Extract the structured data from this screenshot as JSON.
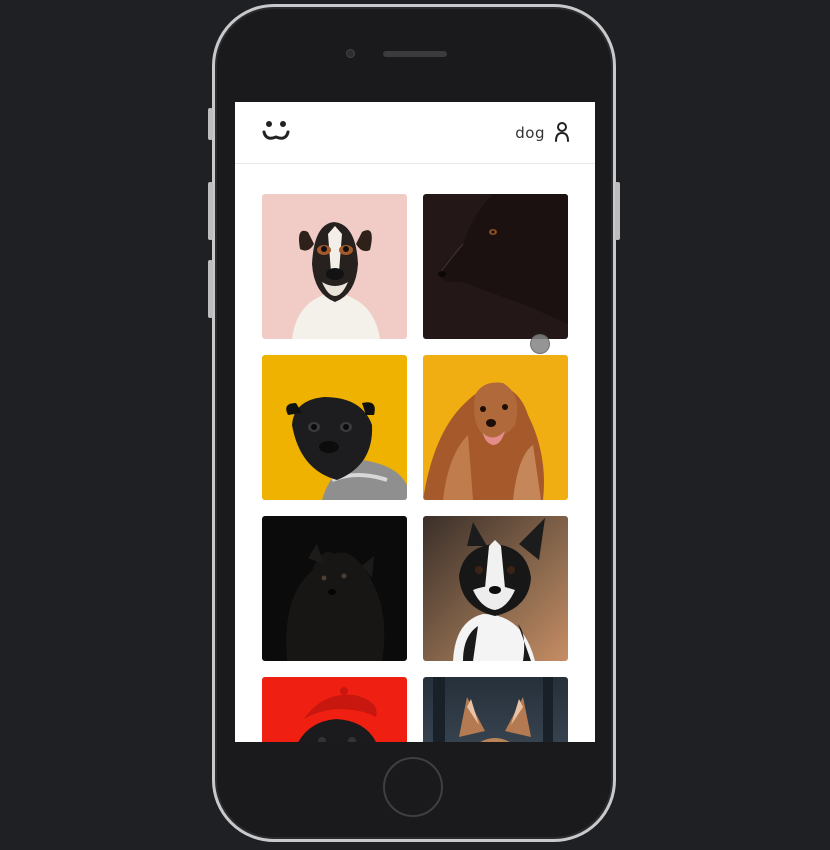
{
  "header": {
    "logo_icon": "dog-face-logo-icon",
    "search_query": "dog",
    "user_icon": "user-icon"
  },
  "photos": [
    {
      "subject": "jack-russell-terrier",
      "background": "#f1cbc6"
    },
    {
      "subject": "black-labrador",
      "background": "#231817"
    },
    {
      "subject": "pug-in-sweater",
      "background": "#efb200"
    },
    {
      "subject": "afghan-hound",
      "background": "#f0ae12"
    },
    {
      "subject": "black-pomeranian",
      "background": "#0c0b0b"
    },
    {
      "subject": "boston-terrier",
      "background": "#7a5a42"
    },
    {
      "subject": "pug-in-red-beret",
      "background": "#ef1f12"
    },
    {
      "subject": "corgi-dark-background",
      "background": "#3e4a56"
    }
  ]
}
